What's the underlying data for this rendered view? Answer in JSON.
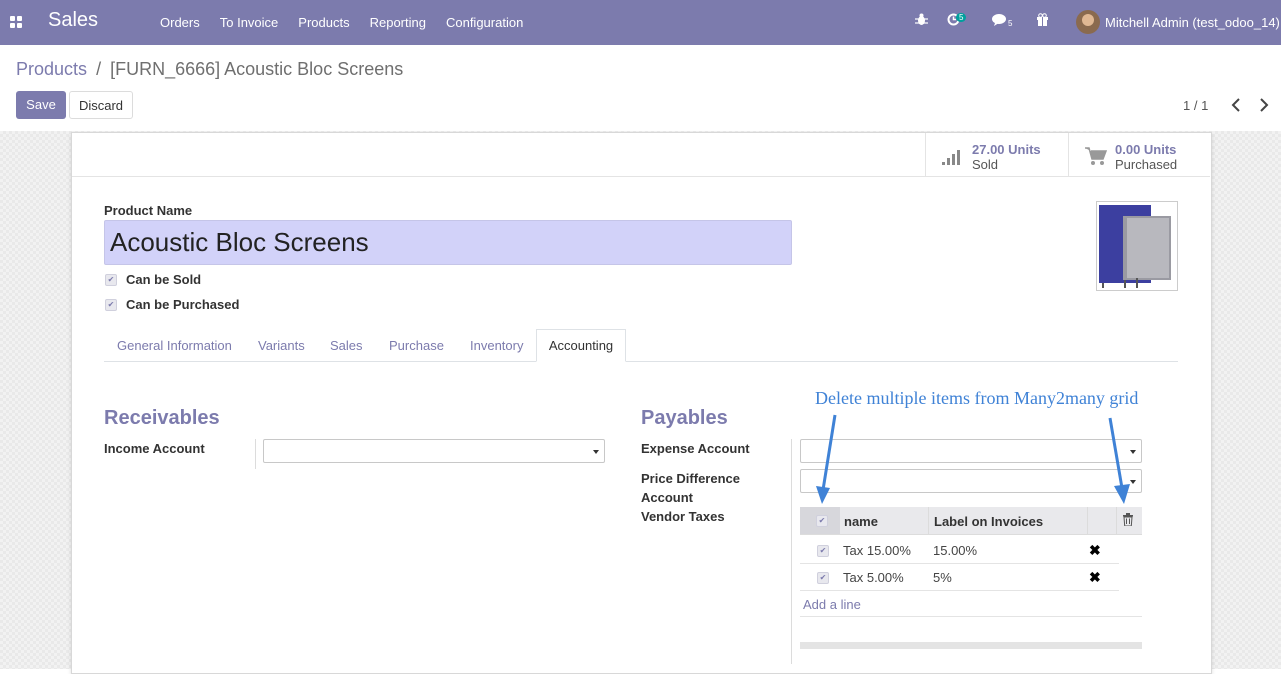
{
  "navbar": {
    "app_name": "Sales",
    "menu": [
      "Orders",
      "To Invoice",
      "Products",
      "Reporting",
      "Configuration"
    ],
    "activity_count": "5",
    "messages_count": "5",
    "user": "Mitchell Admin (test_odoo_14)",
    "color": "#7c7bad"
  },
  "breadcrumb": {
    "parent": "Products",
    "separator": "/",
    "current": "[FURN_6666] Acoustic Bloc Screens"
  },
  "buttons": {
    "save": "Save",
    "discard": "Discard"
  },
  "pager": {
    "text": "1 / 1"
  },
  "smart_buttons": [
    {
      "value": "27.00 Units",
      "label": "Sold",
      "icon": "signal-icon"
    },
    {
      "value": "0.00 Units",
      "label": "Purchased",
      "icon": "cart-icon"
    }
  ],
  "form": {
    "product_name_label": "Product Name",
    "product_name": "Acoustic Bloc Screens",
    "can_be_sold": "Can be Sold",
    "can_be_purchased": "Can be Purchased"
  },
  "tabs": [
    "General Information",
    "Variants",
    "Sales",
    "Purchase",
    "Inventory",
    "Accounting"
  ],
  "active_tab": "Accounting",
  "receivables": {
    "title": "Receivables",
    "income_account_label": "Income Account"
  },
  "payables": {
    "title": "Payables",
    "expense_account_label": "Expense Account",
    "price_difference_label_1": "Price Difference",
    "price_difference_label_2": "Account",
    "vendor_taxes_label": "Vendor Taxes"
  },
  "tax_table": {
    "headers": [
      "name",
      "Label on Invoices"
    ],
    "rows": [
      {
        "name": "Tax 15.00%",
        "label": "15.00%"
      },
      {
        "name": "Tax 5.00%",
        "label": "5%"
      }
    ],
    "add_line": "Add a line"
  },
  "annotation": "Delete multiple items from Many2many grid"
}
